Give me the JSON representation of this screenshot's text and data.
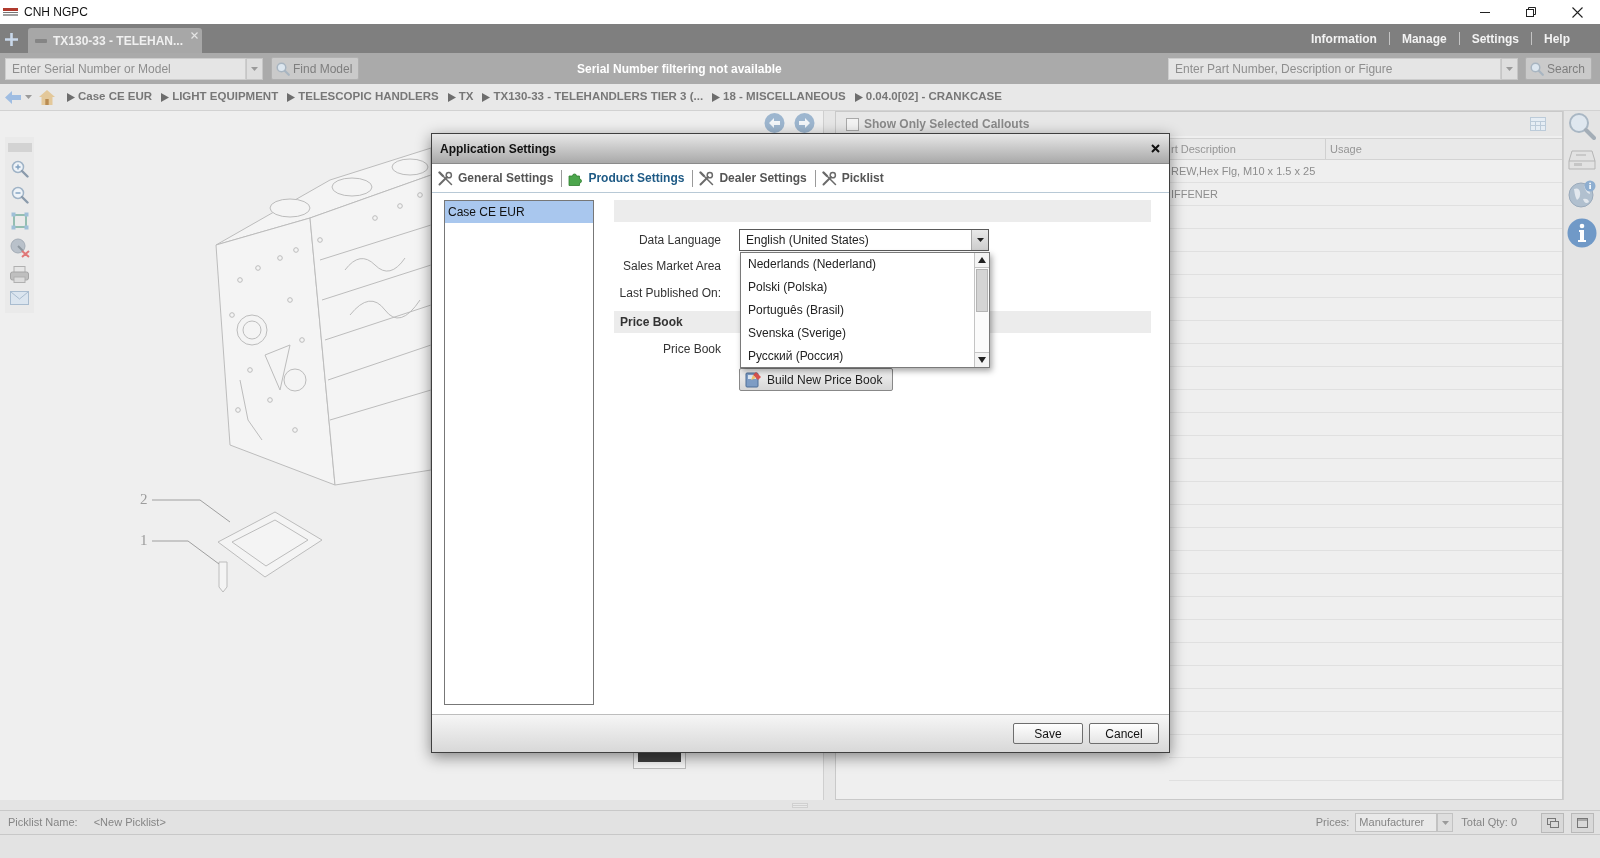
{
  "window": {
    "title": "CNH NGPC"
  },
  "tabs": [
    {
      "label": "TX130-33 - TELEHAN...",
      "selected": true
    }
  ],
  "menu": [
    "Information",
    "Manage",
    "Settings",
    "Help"
  ],
  "toolbar": {
    "serial_search": {
      "placeholder": "Enter Serial Number or Model"
    },
    "find_model": "Find Model",
    "filter_status": "Serial Number filtering not available",
    "part_search": {
      "placeholder": "Enter Part Number, Description or Figure"
    },
    "search": "Search"
  },
  "breadcrumb": [
    "Case CE EUR",
    "LIGHT EQUIPMENT",
    "TELESCOPIC HANDLERS",
    "TX",
    "TX130-33 - TELEHANDLERS TIER 3 (...",
    "18 - MISCELLANEOUS",
    "0.04.0[02] - CRANKCASE"
  ],
  "drawing": {
    "callouts": [
      "2",
      "1"
    ]
  },
  "parts_panel": {
    "callouts_filter": {
      "label": "Show Only Selected Callouts",
      "checked": false
    },
    "columns": [
      "rt Description",
      "Usage"
    ],
    "rows": [
      {
        "description": "REW,Hex Flg, M10 x 1.5 x 25"
      },
      {
        "description": "IFFENER"
      }
    ]
  },
  "status_bar": {
    "picklist_label": "Picklist Name:",
    "picklist_name": "<New Picklist>",
    "prices_label": "Prices:",
    "prices_value": "Manufacturer",
    "total_qty": "Total Qty: 0"
  },
  "dialog": {
    "title": "Application Settings",
    "tabs": [
      {
        "label": "General Settings",
        "kind": "tools",
        "selected": false
      },
      {
        "label": "Product Settings",
        "kind": "puzzle",
        "selected": true
      },
      {
        "label": "Dealer Settings",
        "kind": "tools",
        "selected": false
      },
      {
        "label": "Picklist",
        "kind": "tools",
        "selected": false
      }
    ],
    "products": [
      {
        "label": "Case CE EUR",
        "selected": true
      }
    ],
    "data_language": {
      "label": "Data Language",
      "value": "English (United States)",
      "expanded": true,
      "options": [
        {
          "label": "Nederlands (Nederland)",
          "selected": false
        },
        {
          "label": "Polski (Polska)",
          "selected": false
        },
        {
          "label": "Português (Brasil)",
          "selected": false
        },
        {
          "label": "Svenska (Sverige)",
          "selected": false
        },
        {
          "label": "Русский (Россия)",
          "selected": false
        }
      ]
    },
    "info_labels": [
      "Sales Market Area",
      "Last Published On:"
    ],
    "price_book": {
      "heading": "Price Book",
      "label": "Price Book",
      "button": "Build New Price Book"
    },
    "buttons": [
      "Save",
      "Cancel"
    ]
  }
}
